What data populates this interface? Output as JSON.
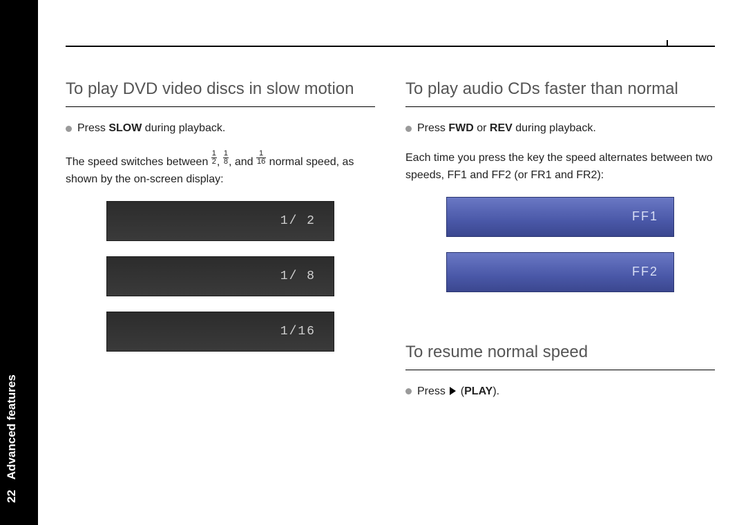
{
  "spine": {
    "page_number": "22",
    "section": "Advanced features"
  },
  "left": {
    "title": "To play DVD video discs in slow motion",
    "bullet_prefix": "Press ",
    "bullet_bold": "SLOW",
    "bullet_suffix": " during playback.",
    "body_a": "The speed switches between ",
    "frac1_n": "1",
    "frac1_d": "2",
    "body_b": ", ",
    "frac2_n": "1",
    "frac2_d": "8",
    "body_c": ", and ",
    "frac3_n": "1",
    "frac3_d": "16",
    "body_d": " normal speed, as shown by the on-screen display:",
    "osd": [
      "1/ 2",
      "1/ 8",
      "1/16"
    ]
  },
  "right": {
    "title1": "To play audio CDs faster than normal",
    "bullet1_prefix": "Press ",
    "bullet1_bold_a": "FWD",
    "bullet1_mid": " or ",
    "bullet1_bold_b": "REV",
    "bullet1_suffix": " during playback.",
    "body1": "Each time you press the key the speed alternates between two speeds, FF1 and FF2 (or FR1 and FR2):",
    "osd": [
      "FF1",
      "FF2"
    ],
    "title2": "To resume normal speed",
    "bullet2_prefix": "Press ",
    "bullet2_paren_open": "(",
    "bullet2_bold": "PLAY",
    "bullet2_paren_close": ")."
  }
}
